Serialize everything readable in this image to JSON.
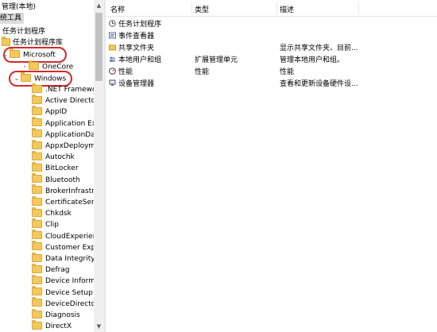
{
  "tree": {
    "root_label": "管理(本地)",
    "system_tools_label": "统工具",
    "task_scheduler_label": "任务计划程序",
    "library_label": "任务计划程序库",
    "microsoft_label": "Microsoft",
    "onecore_label": "OneCore",
    "windows_label": "Windows",
    "windows_children": [
      ".NET Framewo",
      "Active Director",
      "AppID",
      "Application Exp",
      "ApplicationDat",
      "AppxDeployme",
      "Autochk",
      "BitLocker",
      "Bluetooth",
      "BrokerInfrastru",
      "CertificateServi",
      "Chkdsk",
      "Clip",
      "CloudExperien",
      "Customer Expe",
      "Data Integrity S",
      "Defrag",
      "Device Informa",
      "Device Setup",
      "DeviceDirector",
      "Diagnosis",
      "DirectX"
    ]
  },
  "list": {
    "columns": [
      "名称",
      "类型",
      "描述"
    ],
    "rows": [
      {
        "name": "任务计划程序",
        "type": "",
        "desc": "",
        "icon": "task-scheduler-icon"
      },
      {
        "name": "事件查看器",
        "type": "",
        "desc": "",
        "icon": "event-viewer-icon"
      },
      {
        "name": "共享文件夹",
        "type": "",
        "desc": "显示共享文件夹、目前...",
        "icon": "shared-folder-icon"
      },
      {
        "name": "本地用户和组",
        "type": "扩展管理单元",
        "desc": "管理本地用户和组。",
        "icon": "users-icon"
      },
      {
        "name": "性能",
        "type": "性能",
        "desc": "性能",
        "icon": "performance-icon"
      },
      {
        "name": "设备管理器",
        "type": "",
        "desc": "查看和更新设备硬件设...",
        "icon": "device-manager-icon"
      }
    ]
  },
  "colors": {
    "highlight": "#d42a2a",
    "folder": "#f4c85a"
  }
}
